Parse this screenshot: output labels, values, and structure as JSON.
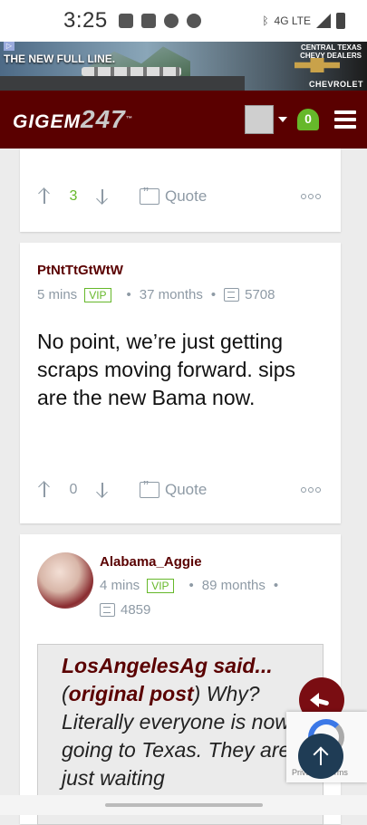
{
  "status_bar": {
    "time": "3:25",
    "network": "4G LTE"
  },
  "ad": {
    "headline": "THE NEW FULL LINE.",
    "dealers": "CHEVY DEALERS",
    "region": "CENTRAL TEXAS",
    "brand": "CHEVROLET",
    "adchoices": "▷"
  },
  "header": {
    "logo_text": "GIGEM",
    "logo_num": "247",
    "notification_count": "0"
  },
  "posts": [
    {
      "vote_count": "3",
      "quote_label": "Quote"
    },
    {
      "username": "PtNtTtGtWtW",
      "age": "5 mins",
      "badge": "VIP",
      "tenure": "37 months",
      "message_count": "5708",
      "body": "No point, we’re just getting scraps moving forward. sips are the new Bama now.",
      "vote_count": "0",
      "quote_label": "Quote"
    },
    {
      "username": "Alabama_Aggie",
      "age": "4 mins",
      "badge": "VIP",
      "tenure": "89 months",
      "message_count": "4859",
      "quote_author": "LosAngelesAg said...",
      "quote_open": "(",
      "quote_link": "original post",
      "quote_close": ")",
      "quote_text": " Why? Literally everyone is now going to Texas. They are just waiting"
    }
  ],
  "recaptcha_text": "Privacy - Terms"
}
